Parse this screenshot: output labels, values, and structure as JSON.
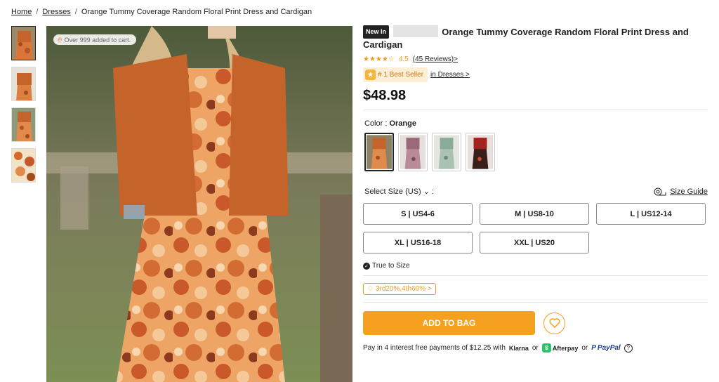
{
  "breadcrumb": {
    "home": "Home",
    "sep": "/",
    "category": "Dresses",
    "current": "Orange Tummy Coverage Random Floral Print Dress and Cardigan"
  },
  "gallery": {
    "cart_badge": "Over 999 added to cart.",
    "thumbnail_count": 4
  },
  "product": {
    "badge": "New In",
    "title": "Orange Tummy Coverage Random Floral Print Dress and Cardigan",
    "rating_value": "4.5",
    "rating_stars": 4.5,
    "reviews": "(45 Reviews)>",
    "seller_badge": "# 1 Best Seller",
    "seller_link": "in Dresses >",
    "price": "$48.98"
  },
  "color": {
    "label": "Color : ",
    "selected": "Orange",
    "swatches": [
      "orange",
      "mauve",
      "sage",
      "dark-red"
    ]
  },
  "size": {
    "label": "Select Size (US)",
    "suffix": ":",
    "guide": "Size Guide",
    "options": [
      "S | US4-6",
      "M | US8-10",
      "L | US12-14",
      "XL | US16-18",
      "XXL | US20"
    ],
    "fit": "True to Size"
  },
  "promo": "3rd20%,4th60% >",
  "cart": {
    "add": "ADD TO BAG"
  },
  "payment": {
    "text": "Pay in 4 interest free payments of $12.25 with",
    "klarna": "Klarna",
    "or1": "or",
    "afterpay": "Afterpay",
    "or2": "or",
    "paypal": "PayPal",
    "help": "?"
  },
  "colors": {
    "accent": "#f5a01e",
    "rating": "#f29a1f",
    "seller_bg": "#fdeed6",
    "dress": "#c4642a"
  }
}
